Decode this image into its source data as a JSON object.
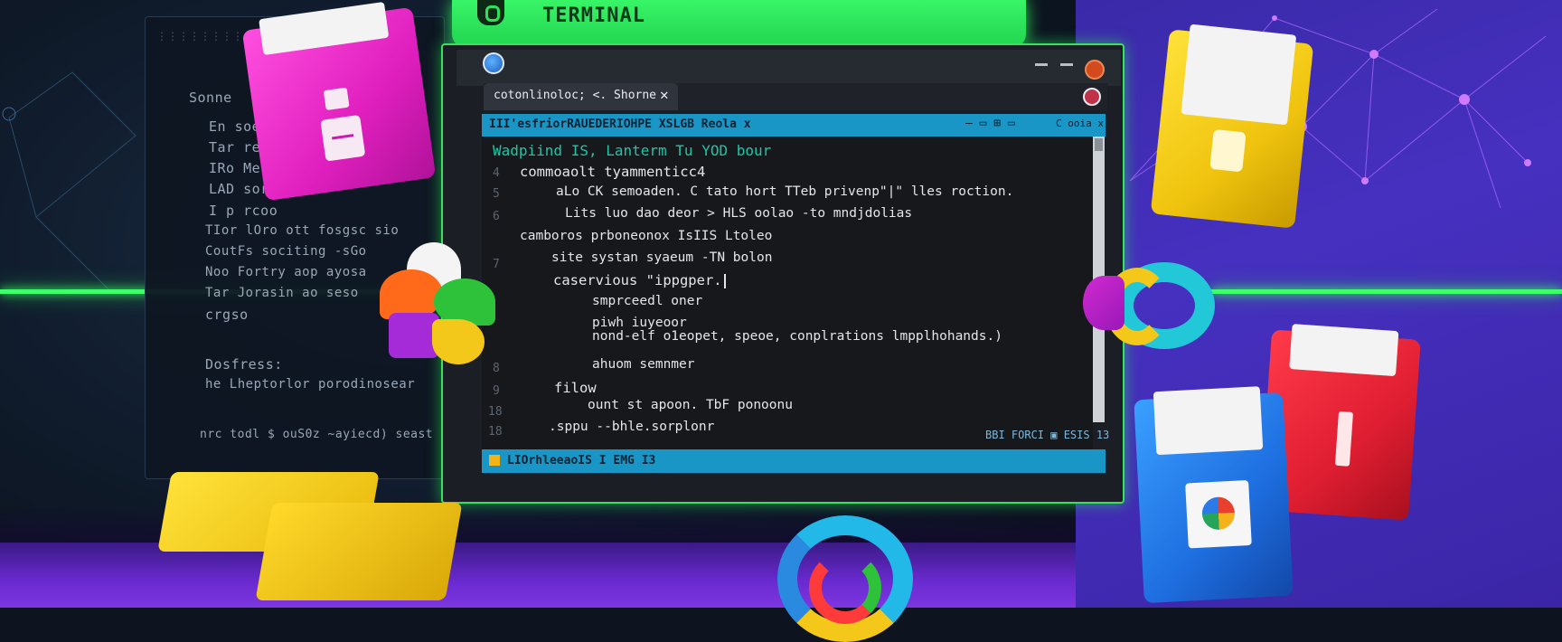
{
  "top_tab": {
    "title": "TERMINAL",
    "icon": "lock-icon"
  },
  "code_panel": {
    "lines": [
      "Sonne",
      "En soen",
      "Tar reo",
      "IRo Me",
      "LAD sore",
      "I p rcoo",
      "TIor lOro  ott  fosgsc  sio",
      "CoutFs sociting  -sGo",
      "Noo Fortry   aop  ayosa",
      "Tar Jorasin  ao  seso",
      "crgso",
      "Dosfress:",
      "he  Lheptorlor  porodinosear",
      "nrc todl  $  ouS0z  ~ayiecd)  seast"
    ]
  },
  "terminal": {
    "tab_label": "cotonlinoloc; <. Shorne",
    "tab_close": "✕",
    "menu_label": "III'esfriorRAUEDERIOHPE XSLGB Reola x",
    "menu_icons": "‒ ▭  ⊞  ▭",
    "menu_right": "C  ooia  x",
    "gutter": [
      "4",
      "5",
      "6",
      "7",
      "8",
      "9",
      "18",
      "18"
    ],
    "code": [
      "Wadpiind IS,  Lanterm  Tu  YOD  bour",
      "commoaolt  tyammenticc4",
      "aLo  CK  semoaden.  C  tato  hort  TTeb  privenp\"|\"  lles  roction.",
      "Lits  luo  dao  deor  >  HLS  oolao  -to  mndjdolias",
      "camboros  prboneonox  IsIIS  Ltoleo",
      "site  systan  syaeum  -TN  bolon",
      "caservious  \"ippgper.",
      "smprceedl  oner",
      "piwh  iuyeoor",
      "nond-elf  o1eopet,  speoe,  conplrations  lmpplhohands.)",
      "ahuom  semnmer",
      "filow",
      "ount  st  apoon.  TbF  ponoonu",
      ".sppu  --bhle.sorplonr"
    ],
    "editor_status": "BBI FORCI  ▣  ESIS  13",
    "status_label": "LIOrhleeaoIS  I  EMG  I3"
  },
  "colors": {
    "accent_green": "#38f567",
    "terminal_bg": "#16181c",
    "bar_cyan": "#1a96c6",
    "panel_bg": "#0f1a2a",
    "purple_bg": "#4630c0"
  }
}
